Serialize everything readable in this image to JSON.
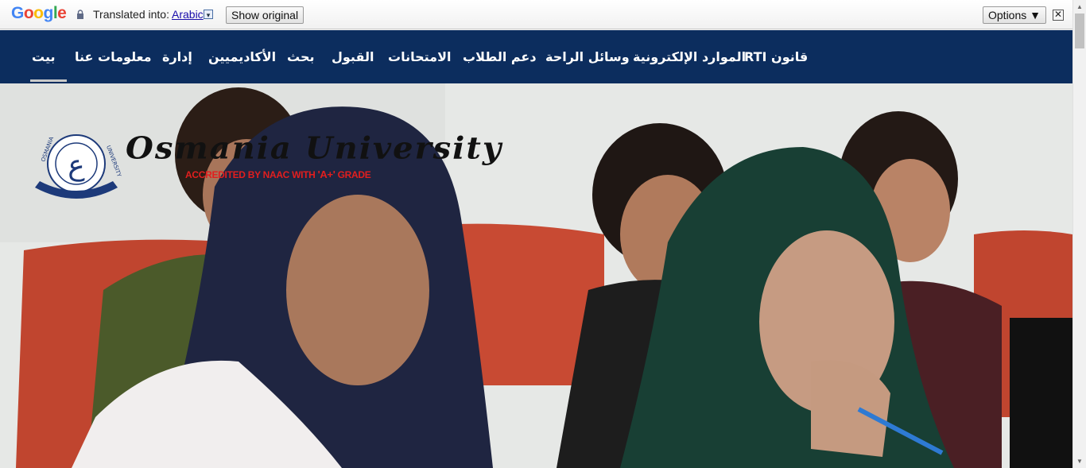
{
  "translate_bar": {
    "logo": "Google",
    "label": "Translated into:",
    "language": "Arabic",
    "dropdown_glyph": "▾",
    "show_original": "Show original",
    "options": "Options ▼",
    "close": "✕",
    "icons": {
      "lock": "lock-icon"
    }
  },
  "nav": {
    "items": [
      "بيت",
      "معلومات عنا",
      "إدارة",
      "الأكاديميين",
      "بحث",
      "القبول",
      "الامتحانات",
      "دعم الطلاب",
      "وسائل الراحة",
      "الموارد الإلكترونية",
      "RTI قانون"
    ],
    "active_index": 0,
    "background": "#0c2d5e"
  },
  "hero": {
    "university_name": "Osmania University",
    "accreditation_prefix": "ACCREDITED BY NAAC WITH ",
    "accreditation_grade": "'A+'",
    "accreditation_suffix": " GRADE",
    "seal_label_left": "OSMANIA",
    "seal_label_right": "UNIVERSITY",
    "accent": "#e21e1e"
  }
}
